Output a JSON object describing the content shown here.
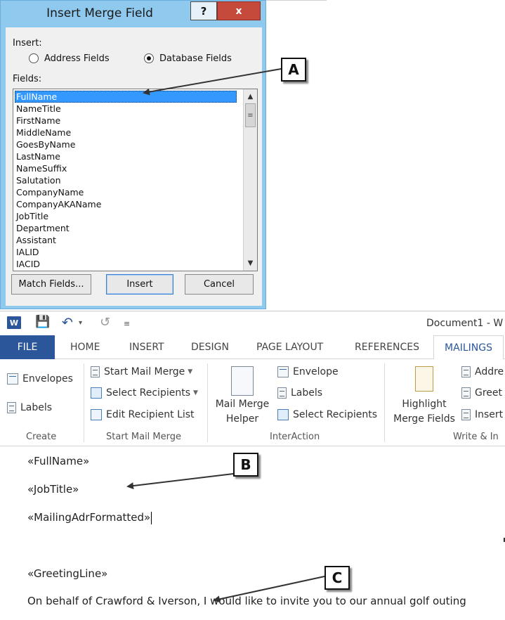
{
  "dialog": {
    "title": "Insert Merge Field",
    "help_label": "?",
    "close_label": "x",
    "insert_label": "Insert:",
    "radio_address": "Address Fields",
    "radio_database": "Database Fields",
    "fields_label": "Fields:",
    "fields": [
      "FullName",
      "NameTitle",
      "FirstName",
      "MiddleName",
      "GoesByName",
      "LastName",
      "NameSuffix",
      "Salutation",
      "CompanyName",
      "CompanyAKAName",
      "JobTitle",
      "Department",
      "Assistant",
      "IALID",
      "IACID"
    ],
    "selected_field": "FullName",
    "buttons": {
      "match": "Match Fields...",
      "insert": "Insert",
      "cancel": "Cancel"
    }
  },
  "callouts": {
    "a": "A",
    "b": "B",
    "c": "C"
  },
  "word": {
    "doc_title": "Document1 - W",
    "logo": "W",
    "tabs": [
      "FILE",
      "HOME",
      "INSERT",
      "DESIGN",
      "PAGE LAYOUT",
      "REFERENCES",
      "MAILINGS"
    ],
    "active_tab": "MAILINGS",
    "ribbon": {
      "create": {
        "envelopes": "Envelopes",
        "labels": "Labels",
        "label": "Create"
      },
      "start": {
        "start_mail_merge": "Start Mail Merge",
        "select_recipients": "Select Recipients",
        "edit_recipient_list": "Edit Recipient List",
        "label": "Start Mail Merge"
      },
      "interaction": {
        "helper_line1": "Mail Merge",
        "helper_line2": "Helper",
        "envelope": "Envelope",
        "labels": "Labels",
        "select_recipients": "Select Recipients",
        "label": "InterAction"
      },
      "write": {
        "highlight_line1": "Highlight",
        "highlight_line2": "Merge Fields",
        "address": "Addre",
        "greeting": "Greet",
        "insert": "Insert",
        "label": "Write & In"
      }
    },
    "document": {
      "line1": "«FullName»",
      "line2": "«JobTitle»",
      "line3": "«MailingAdrFormatted»",
      "line4": "«GreetingLine»",
      "line5": "On behalf of Crawford & Iverson, I would like to invite you to our annual golf outing"
    }
  }
}
